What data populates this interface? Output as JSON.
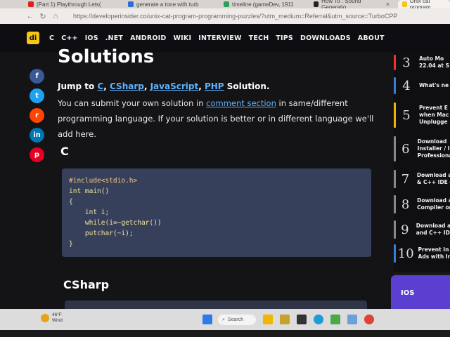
{
  "browser": {
    "tabs": [
      {
        "label": "(Part 1) Playthrough Lets(",
        "color": "#e02020"
      },
      {
        "label": "generate a tone with turb",
        "color": "#2b6fd6"
      },
      {
        "label": "timeline (gameDev, 1911",
        "color": "#2aa35a"
      },
      {
        "label": "How To : Sound Generatio",
        "color": "#222222"
      },
      {
        "label": "Unix cat program",
        "color": "#f5c518"
      }
    ],
    "url": "https://developerinsider.co/unix-cat-program-programming-puzzles/?utm_medium=Referral&utm_source=TurboCPP"
  },
  "navbar": {
    "logo": "di",
    "links": [
      "C",
      "C++",
      "IOS",
      ".NET",
      "ANDROID",
      "WIKI",
      "INTERVIEW",
      "TECH",
      "TIPS",
      "DOWNLOADS",
      "ABOUT"
    ]
  },
  "article": {
    "heading": "Solutions",
    "jump_label": "Jump to",
    "jump_links": [
      "C",
      "CSharp",
      "JavaScript",
      "PHP"
    ],
    "jump_tail": "Solution.",
    "para_before": "You can submit your own solution in",
    "para_link": "comment section",
    "para_after": "in same/different programming language. If your solution is better or in different language we'll add here.",
    "section_c": "C",
    "code_lines": [
      "#include<stdio.h>",
      "int main()",
      "{",
      "    int i;",
      "    while(i=~getchar())",
      "    putchar(~i);",
      "}"
    ],
    "section_csharp": "CSharp"
  },
  "social": [
    {
      "name": "facebook",
      "glyph": "f",
      "color": "#3b5998"
    },
    {
      "name": "twitter",
      "glyph": "t",
      "color": "#1da1f2"
    },
    {
      "name": "reddit",
      "glyph": "r",
      "color": "#ff4500"
    },
    {
      "name": "linkedin",
      "glyph": "in",
      "color": "#0077b5"
    },
    {
      "name": "pinterest",
      "glyph": "p",
      "color": "#e60023"
    }
  ],
  "sidebar": {
    "items": [
      {
        "num": "3",
        "text": [
          "Auto Mo",
          "22.04 at S"
        ],
        "color": "#e33"
      },
      {
        "num": "4",
        "text": [
          "What's ne"
        ],
        "color": "#3a7bd5"
      },
      {
        "num": "5",
        "text": [
          "Prevent E",
          "when Mac",
          "Unplugge"
        ],
        "color": "#f0b400"
      },
      {
        "num": "6",
        "text": [
          "Download",
          "Installer / I",
          "Professiona"
        ],
        "color": "#888"
      },
      {
        "num": "7",
        "text": [
          "Download a",
          "& C++ IDE o"
        ],
        "color": "#888"
      },
      {
        "num": "8",
        "text": [
          "Download a",
          "Compiler on"
        ],
        "color": "#888"
      },
      {
        "num": "9",
        "text": [
          "Download an",
          "and C++ IDE"
        ],
        "color": "#888"
      },
      {
        "num": "10",
        "text": [
          "Prevent In",
          "Ads with In"
        ],
        "color": "#3a7bd5"
      }
    ],
    "ios_label": "IOS"
  },
  "taskbar": {
    "weather_temp": "46°F",
    "weather_cond": "Wind",
    "search_label": "Search"
  }
}
